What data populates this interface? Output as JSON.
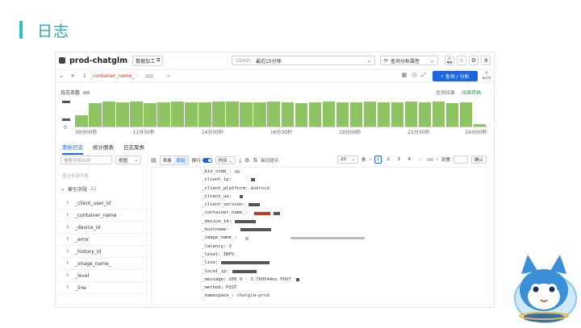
{
  "slide": {
    "title": "日志"
  },
  "topbar": {
    "project": "prod-chatglm",
    "process_button": "数据加工",
    "time_preset": "15min",
    "time_range": "最近15分钟",
    "analysis_button": "查询分析属性",
    "icons": [
      "refresh-icon",
      "bell-icon",
      "star-icon",
      "gear-icon",
      "share-icon"
    ]
  },
  "query": {
    "line_no": "1",
    "text": "_container_name_ :",
    "arrow": "->",
    "search_button": "查询 / 分析",
    "auto_label": "auto"
  },
  "histogram": {
    "title": "日志条数",
    "y_top": "",
    "y_zero": "0",
    "link_result": "查询结果",
    "link_accurate": "结果精确",
    "x_labels": [
      "09分00秒",
      "11分30秒",
      "14分00秒",
      "16分30秒",
      "19分00秒",
      "21分30秒",
      "24分00秒"
    ]
  },
  "chart_data": {
    "type": "bar",
    "title": "日志条数",
    "xlabel": "",
    "ylabel": "",
    "ylim": [
      0,
      1
    ],
    "x_tick_labels": [
      "09分00秒",
      "11分30秒",
      "14分00秒",
      "16分30秒",
      "19分00秒",
      "21分30秒",
      "24分00秒"
    ],
    "values": [
      0.4,
      0.85,
      0.9,
      0.88,
      0.9,
      0.86,
      0.88,
      0.9,
      0.87,
      0.88,
      0.92,
      0.9,
      0.88,
      0.87,
      0.9,
      0.88,
      0.86,
      0.88,
      0.9,
      0.87,
      0.88,
      0.9,
      0.89,
      0.87,
      0.9,
      0.88,
      0.9,
      0.86,
      0.88,
      0.1
    ]
  },
  "tabs": [
    {
      "label": "原始日志",
      "active": true
    },
    {
      "label": "统计图表",
      "active": false
    },
    {
      "label": "日志聚类",
      "active": false
    }
  ],
  "sidebar": {
    "search_placeholder": "搜索字段名称",
    "view_label": "视图",
    "show_all": "显示全部字段",
    "index_title": "索引字段",
    "index_count": "21",
    "fields": [
      {
        "type": "t",
        "name": "_client_user_id"
      },
      {
        "type": "t",
        "name": "_container_name",
        "extra": "-"
      },
      {
        "type": "t",
        "name": "_device_id"
      },
      {
        "type": "t",
        "name": "_error"
      },
      {
        "type": "t",
        "name": "_history_id"
      },
      {
        "type": "t",
        "name": "_image_name_"
      },
      {
        "type": "t",
        "name": "_level"
      },
      {
        "type": "t",
        "name": "_line"
      }
    ]
  },
  "toolbar": {
    "table_label": "表格",
    "raw_label": "原始",
    "wrap_label": "换行",
    "time_label": "时间",
    "sort_label": "新旧提示",
    "per_page": "20",
    "total_prefix": "条",
    "pages": [
      "1",
      "2",
      "3",
      "4",
      "..."
    ],
    "goto_label": "到第",
    "confirm_label": "确认"
  },
  "log": [
    {
      "key": "_biz_code_:",
      "value": ""
    },
    {
      "key": "_client_ip:",
      "value": ""
    },
    {
      "key": "_client_platform:",
      "value": "android"
    },
    {
      "key": "_client_ua:",
      "value": ""
    },
    {
      "key": "_client_version:",
      "value": ""
    },
    {
      "key": "_container_name_:",
      "value": ""
    },
    {
      "key": "_device_id:",
      "value": ""
    },
    {
      "key": "_hostname:",
      "value": ""
    },
    {
      "key": "_image_name_:",
      "value": ""
    },
    {
      "key": "_latency:",
      "value": "3"
    },
    {
      "key": "_level:",
      "value": "INFO"
    },
    {
      "key": "_line:",
      "value": ""
    },
    {
      "key": "_local_ip:",
      "value": ""
    },
    {
      "key": "_message:",
      "value": "200 0 - 3.760544ms POST"
    },
    {
      "key": "_method:",
      "value": "POST"
    },
    {
      "key": "_namespace_:",
      "value": "chatglm-prod"
    }
  ]
}
